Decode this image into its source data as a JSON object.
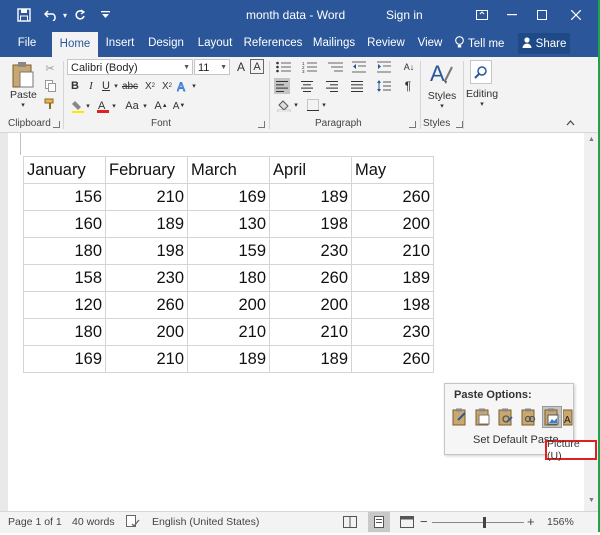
{
  "titlebar": {
    "doc_title": "month data - Word",
    "signin": "Sign in"
  },
  "tabs": [
    {
      "label": "File"
    },
    {
      "label": "Home"
    },
    {
      "label": "Insert"
    },
    {
      "label": "Design"
    },
    {
      "label": "Layout"
    },
    {
      "label": "References"
    },
    {
      "label": "Mailings"
    },
    {
      "label": "Review"
    },
    {
      "label": "View"
    }
  ],
  "tell_me": "Tell me",
  "share": "Share",
  "ribbon": {
    "paste_label": "Paste",
    "font_name": "Calibri (Body)",
    "font_size": "11",
    "styles_label": "Styles",
    "editing_label": "Editing",
    "groups": {
      "clipboard": "Clipboard",
      "font": "Font",
      "paragraph": "Paragraph",
      "styles": "Styles"
    }
  },
  "table": {
    "headers": [
      "January",
      "February",
      "March",
      "April",
      "May"
    ],
    "rows": [
      [
        "156",
        "210",
        "169",
        "189",
        "260"
      ],
      [
        "160",
        "189",
        "130",
        "198",
        "200"
      ],
      [
        "180",
        "198",
        "159",
        "230",
        "210"
      ],
      [
        "158",
        "230",
        "180",
        "260",
        "189"
      ],
      [
        "120",
        "260",
        "200",
        "200",
        "198"
      ],
      [
        "180",
        "200",
        "210",
        "210",
        "230"
      ],
      [
        "169",
        "210",
        "189",
        "189",
        "260"
      ]
    ]
  },
  "paste_options": {
    "title": "Paste Options:",
    "default": "Set Default Paste",
    "tooltip": "Picture (U)"
  },
  "status": {
    "page": "Page 1 of 1",
    "words": "40 words",
    "language": "English (United States)",
    "zoom": "156%"
  },
  "colors": {
    "accent": "#2b579a",
    "highlight_box": "#e02020"
  }
}
